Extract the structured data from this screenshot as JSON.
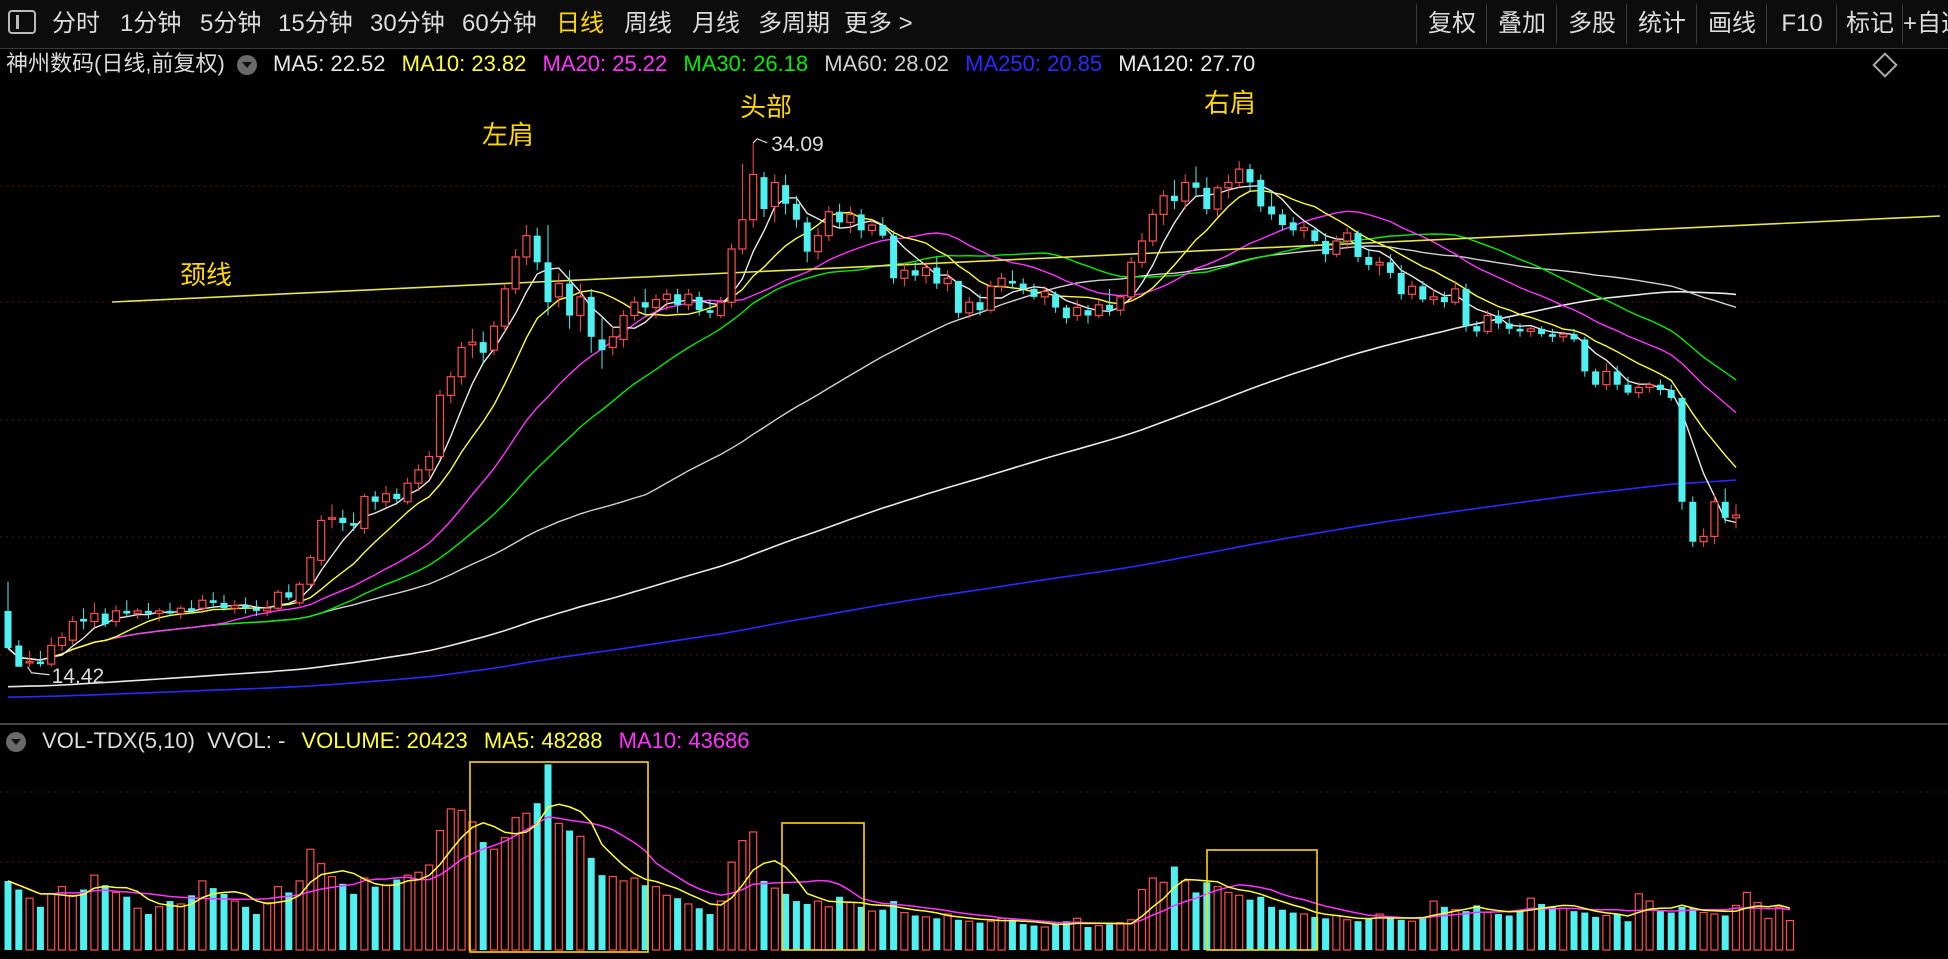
{
  "toolbar": {
    "periods": [
      "分时",
      "1分钟",
      "5分钟",
      "15分钟",
      "30分钟",
      "60分钟",
      "日线",
      "周线",
      "月线",
      "多周期",
      "更多 >"
    ],
    "active_period": "日线",
    "tools": [
      "复权",
      "叠加",
      "多股",
      "统计",
      "画线",
      "F10",
      "标记",
      "+自选"
    ]
  },
  "main_legend": {
    "stock": "神州数码(日线,前复权)",
    "ma5": "MA5: 22.52",
    "ma10": "MA10: 23.82",
    "ma20": "MA20: 25.22",
    "ma30": "MA30: 26.18",
    "ma60": "MA60: 28.02",
    "ma250": "MA250: 20.85",
    "ma120": "MA120: 27.70"
  },
  "vol_legend": {
    "name": "VOL-TDX(5,10)",
    "vvol": "VVOL: -",
    "volume": "VOLUME: 20423",
    "ma5": "MA5: 48288",
    "ma10": "MA10: 43686"
  },
  "colors": {
    "up": "#ff4d4d",
    "down": "#4ff0f0",
    "ma5": "#e8e8e8",
    "ma10": "#ffff33",
    "ma20": "#ff33ff",
    "ma30": "#00ee00",
    "ma60": "#d0d0d0",
    "ma250": "#2a2aff",
    "ma120": "#e8e8e8",
    "annotation": "#ffd700",
    "bg": "#000000"
  },
  "chart_data": {
    "type": "candlestick",
    "price_range": [
      12.4,
      36.3
    ],
    "high_label": "34.09",
    "low_label": "14.42",
    "annotations": [
      "左肩",
      "头部",
      "右肩",
      "颈线"
    ],
    "candles": [
      [
        16.5,
        17.6,
        15.3,
        15.1
      ],
      [
        15.2,
        15.4,
        14.5,
        14.4
      ],
      [
        14.6,
        15.0,
        14.4,
        14.6
      ],
      [
        14.6,
        15.0,
        14.4,
        14.5
      ],
      [
        14.5,
        15.5,
        14.4,
        15.2
      ],
      [
        15.2,
        15.7,
        15.0,
        15.5
      ],
      [
        15.4,
        16.3,
        15.2,
        16.1
      ],
      [
        16.2,
        16.6,
        15.8,
        16.1
      ],
      [
        16.1,
        16.8,
        15.9,
        16.4
      ],
      [
        16.4,
        16.6,
        15.9,
        16.0
      ],
      [
        16.1,
        16.7,
        15.9,
        16.5
      ],
      [
        16.5,
        16.9,
        16.3,
        16.4
      ],
      [
        16.4,
        16.6,
        16.2,
        16.5
      ],
      [
        16.5,
        16.8,
        16.2,
        16.4
      ],
      [
        16.4,
        16.6,
        16.1,
        16.5
      ],
      [
        16.5,
        16.8,
        16.3,
        16.4
      ],
      [
        16.4,
        16.7,
        16.2,
        16.6
      ],
      [
        16.6,
        16.9,
        16.4,
        16.5
      ],
      [
        16.6,
        17.1,
        16.4,
        16.9
      ],
      [
        16.9,
        17.2,
        16.6,
        16.8
      ],
      [
        16.8,
        17.1,
        16.5,
        16.6
      ],
      [
        16.6,
        16.9,
        16.4,
        16.7
      ],
      [
        16.7,
        17.0,
        16.4,
        16.6
      ],
      [
        16.6,
        16.9,
        16.3,
        16.5
      ],
      [
        16.5,
        16.9,
        16.3,
        16.6
      ],
      [
        16.6,
        17.3,
        16.5,
        17.2
      ],
      [
        17.2,
        17.5,
        16.9,
        17.0
      ],
      [
        16.8,
        17.6,
        16.7,
        17.5
      ],
      [
        17.5,
        18.6,
        17.4,
        18.5
      ],
      [
        18.4,
        20.1,
        18.2,
        19.9
      ],
      [
        20.0,
        20.5,
        19.6,
        20.0
      ],
      [
        20.0,
        20.3,
        19.5,
        19.8
      ],
      [
        19.8,
        20.2,
        19.5,
        19.7
      ],
      [
        19.6,
        20.9,
        19.4,
        20.8
      ],
      [
        20.8,
        21.0,
        20.3,
        20.6
      ],
      [
        20.6,
        21.2,
        20.4,
        20.9
      ],
      [
        20.9,
        21.1,
        20.5,
        20.7
      ],
      [
        20.6,
        21.5,
        20.5,
        21.3
      ],
      [
        21.3,
        22.0,
        21.0,
        21.8
      ],
      [
        21.8,
        22.5,
        21.5,
        22.3
      ],
      [
        22.3,
        24.8,
        22.2,
        24.6
      ],
      [
        24.6,
        25.5,
        24.3,
        25.3
      ],
      [
        25.3,
        26.6,
        25.0,
        26.4
      ],
      [
        26.5,
        27.1,
        26.0,
        26.6
      ],
      [
        26.6,
        27.0,
        25.8,
        26.2
      ],
      [
        26.3,
        27.4,
        26.1,
        27.2
      ],
      [
        27.2,
        28.8,
        27.0,
        28.6
      ],
      [
        28.6,
        30.1,
        28.4,
        29.8
      ],
      [
        29.8,
        31.0,
        29.5,
        30.6
      ],
      [
        30.6,
        30.9,
        29.3,
        29.6
      ],
      [
        29.6,
        31.0,
        27.6,
        28.1
      ],
      [
        28.3,
        29.2,
        27.9,
        28.8
      ],
      [
        28.8,
        29.3,
        27.1,
        27.6
      ],
      [
        27.6,
        28.8,
        27.0,
        28.3
      ],
      [
        28.3,
        28.6,
        26.2,
        26.8
      ],
      [
        26.7,
        27.5,
        25.6,
        26.3
      ],
      [
        26.4,
        27.2,
        26.1,
        26.8
      ],
      [
        26.7,
        27.8,
        26.4,
        27.6
      ],
      [
        27.6,
        28.3,
        27.4,
        28.1
      ],
      [
        28.1,
        28.6,
        27.6,
        27.9
      ],
      [
        27.9,
        28.4,
        27.5,
        28.2
      ],
      [
        28.2,
        28.6,
        27.8,
        28.4
      ],
      [
        28.4,
        28.6,
        27.7,
        28.0
      ],
      [
        28.0,
        28.6,
        27.8,
        28.4
      ],
      [
        28.3,
        28.5,
        27.6,
        27.8
      ],
      [
        27.8,
        28.2,
        27.5,
        27.7
      ],
      [
        27.6,
        28.3,
        27.5,
        28.1
      ],
      [
        28.1,
        30.3,
        27.9,
        30.1
      ],
      [
        30.1,
        33.3,
        29.9,
        31.2
      ],
      [
        31.2,
        34.09,
        30.9,
        32.9
      ],
      [
        32.8,
        33.0,
        31.3,
        31.6
      ],
      [
        31.7,
        32.9,
        31.1,
        32.6
      ],
      [
        32.5,
        32.9,
        31.4,
        31.8
      ],
      [
        31.8,
        32.1,
        30.9,
        31.2
      ],
      [
        31.1,
        31.3,
        29.6,
        30.0
      ],
      [
        30.0,
        30.9,
        29.7,
        30.6
      ],
      [
        30.6,
        31.7,
        30.4,
        31.5
      ],
      [
        31.5,
        31.8,
        30.9,
        31.1
      ],
      [
        31.1,
        31.7,
        30.7,
        31.4
      ],
      [
        31.4,
        31.6,
        30.5,
        30.8
      ],
      [
        30.8,
        31.2,
        30.6,
        31.0
      ],
      [
        31.0,
        31.3,
        30.5,
        30.6
      ],
      [
        30.6,
        30.8,
        28.8,
        29.0
      ],
      [
        29.0,
        29.6,
        28.7,
        29.3
      ],
      [
        29.3,
        29.6,
        28.9,
        29.1
      ],
      [
        29.1,
        29.6,
        28.8,
        29.4
      ],
      [
        29.4,
        29.8,
        28.6,
        28.8
      ],
      [
        28.8,
        29.3,
        28.5,
        29.0
      ],
      [
        28.9,
        28.9,
        27.5,
        27.7
      ],
      [
        27.7,
        28.3,
        27.5,
        28.1
      ],
      [
        28.1,
        28.4,
        27.6,
        27.8
      ],
      [
        27.8,
        28.9,
        27.7,
        28.7
      ],
      [
        28.7,
        29.2,
        28.5,
        29.0
      ],
      [
        28.9,
        29.3,
        28.6,
        28.8
      ],
      [
        28.8,
        29.0,
        28.4,
        28.6
      ],
      [
        28.6,
        28.8,
        28.2,
        28.3
      ],
      [
        28.3,
        28.7,
        28.0,
        28.5
      ],
      [
        28.4,
        28.5,
        27.7,
        27.9
      ],
      [
        27.9,
        28.0,
        27.3,
        27.5
      ],
      [
        27.6,
        28.2,
        27.4,
        27.9
      ],
      [
        27.8,
        28.0,
        27.3,
        27.6
      ],
      [
        27.6,
        28.2,
        27.5,
        28.0
      ],
      [
        28.0,
        28.6,
        27.6,
        27.8
      ],
      [
        27.8,
        28.4,
        27.6,
        28.3
      ],
      [
        28.3,
        29.8,
        28.1,
        29.6
      ],
      [
        29.6,
        30.7,
        29.4,
        30.4
      ],
      [
        30.4,
        31.6,
        30.2,
        31.4
      ],
      [
        31.4,
        32.3,
        31.0,
        32.1
      ],
      [
        32.1,
        32.7,
        31.6,
        31.9
      ],
      [
        31.9,
        32.9,
        31.6,
        32.6
      ],
      [
        32.6,
        33.2,
        32.1,
        32.4
      ],
      [
        32.4,
        32.8,
        31.4,
        31.6
      ],
      [
        31.6,
        32.5,
        31.3,
        32.4
      ],
      [
        32.4,
        32.9,
        32.0,
        32.6
      ],
      [
        32.6,
        33.4,
        32.4,
        33.1
      ],
      [
        33.1,
        33.3,
        32.3,
        32.6
      ],
      [
        32.7,
        32.9,
        31.5,
        31.7
      ],
      [
        31.7,
        32.3,
        31.2,
        31.4
      ],
      [
        31.4,
        31.6,
        30.8,
        31.0
      ],
      [
        31.1,
        31.3,
        30.6,
        30.8
      ],
      [
        30.8,
        31.1,
        30.5,
        30.9
      ],
      [
        30.8,
        30.9,
        30.3,
        30.4
      ],
      [
        30.4,
        30.7,
        29.6,
        29.9
      ],
      [
        29.9,
        30.6,
        29.8,
        30.4
      ],
      [
        30.4,
        30.9,
        30.1,
        30.7
      ],
      [
        30.7,
        30.8,
        29.6,
        29.8
      ],
      [
        29.8,
        30.1,
        29.3,
        29.5
      ],
      [
        29.5,
        29.8,
        29.1,
        29.6
      ],
      [
        29.6,
        29.9,
        29.0,
        29.2
      ],
      [
        29.2,
        29.5,
        28.2,
        28.4
      ],
      [
        28.4,
        28.9,
        28.2,
        28.7
      ],
      [
        28.7,
        28.9,
        28.1,
        28.2
      ],
      [
        28.2,
        28.6,
        28.0,
        28.3
      ],
      [
        28.3,
        28.5,
        27.9,
        28.1
      ],
      [
        28.1,
        28.9,
        28.0,
        28.6
      ],
      [
        28.6,
        28.8,
        27.0,
        27.2
      ],
      [
        27.2,
        27.4,
        26.8,
        27.0
      ],
      [
        27.0,
        27.8,
        26.9,
        27.6
      ],
      [
        27.6,
        27.8,
        27.1,
        27.3
      ],
      [
        27.3,
        27.5,
        26.9,
        27.1
      ],
      [
        27.1,
        27.3,
        26.8,
        27.0
      ],
      [
        27.0,
        27.2,
        26.8,
        27.1
      ],
      [
        27.1,
        27.2,
        26.8,
        26.9
      ],
      [
        26.9,
        27.1,
        26.6,
        26.8
      ],
      [
        26.8,
        27.0,
        26.6,
        26.9
      ],
      [
        26.9,
        27.1,
        26.6,
        26.7
      ],
      [
        26.7,
        26.8,
        25.3,
        25.5
      ],
      [
        25.5,
        25.6,
        24.9,
        25.0
      ],
      [
        25.0,
        25.8,
        24.8,
        25.5
      ],
      [
        25.5,
        25.7,
        24.8,
        25.0
      ],
      [
        25.0,
        25.3,
        24.6,
        24.7
      ],
      [
        24.7,
        25.1,
        24.5,
        24.9
      ],
      [
        24.9,
        25.1,
        24.7,
        25.0
      ],
      [
        25.0,
        25.2,
        24.6,
        24.8
      ],
      [
        24.8,
        25.0,
        24.4,
        24.5
      ],
      [
        24.5,
        24.6,
        20.3,
        20.6
      ],
      [
        20.6,
        20.8,
        18.9,
        19.1
      ],
      [
        19.1,
        19.6,
        18.9,
        19.3
      ],
      [
        19.3,
        20.9,
        19.0,
        20.6
      ],
      [
        20.6,
        21.1,
        19.8,
        20.0
      ],
      [
        20.0,
        20.5,
        19.6,
        20.1
      ]
    ],
    "volumes": [
      48000,
      42000,
      36000,
      30000,
      39000,
      44000,
      38000,
      42000,
      52000,
      45000,
      40000,
      37000,
      29000,
      25000,
      30000,
      34000,
      32000,
      38000,
      48000,
      43000,
      39000,
      34000,
      30000,
      25000,
      33000,
      44000,
      40000,
      48000,
      70000,
      60000,
      51000,
      46000,
      39000,
      50000,
      44000,
      45000,
      49000,
      52000,
      54000,
      59000,
      83000,
      98000,
      97000,
      89000,
      75000,
      70000,
      78000,
      92000,
      95000,
      102000,
      129000,
      88000,
      83000,
      79000,
      64000,
      52000,
      51000,
      48000,
      50000,
      45000,
      44000,
      38000,
      36000,
      32000,
      29000,
      25000,
      34000,
      61000,
      76000,
      82000,
      48000,
      43000,
      39000,
      34000,
      32000,
      34000,
      30000,
      37000,
      33000,
      30000,
      27000,
      28000,
      34000,
      26000,
      24000,
      23000,
      22000,
      25000,
      21000,
      20000,
      19000,
      20000,
      22000,
      21000,
      18000,
      17000,
      16000,
      18000,
      20000,
      22000,
      16000,
      17000,
      18000,
      19000,
      21000,
      42000,
      50000,
      47000,
      58000,
      48000,
      40000,
      47000,
      44000,
      40000,
      38000,
      35000,
      37000,
      30000,
      28000,
      26000,
      25000,
      23000,
      22000,
      24000,
      21000,
      20000,
      22000,
      25000,
      23000,
      21000,
      20000,
      23000,
      34000,
      30000,
      28000,
      27000,
      31000,
      26000,
      25000,
      24000,
      28000,
      36000,
      32000,
      30000,
      29000,
      27000,
      26000,
      23000,
      24000,
      25000,
      20000,
      39000,
      34000,
      27000,
      26000,
      30000,
      29000,
      26000,
      25000,
      24000,
      31000,
      40000,
      33000,
      22000,
      30000,
      20423
    ]
  }
}
